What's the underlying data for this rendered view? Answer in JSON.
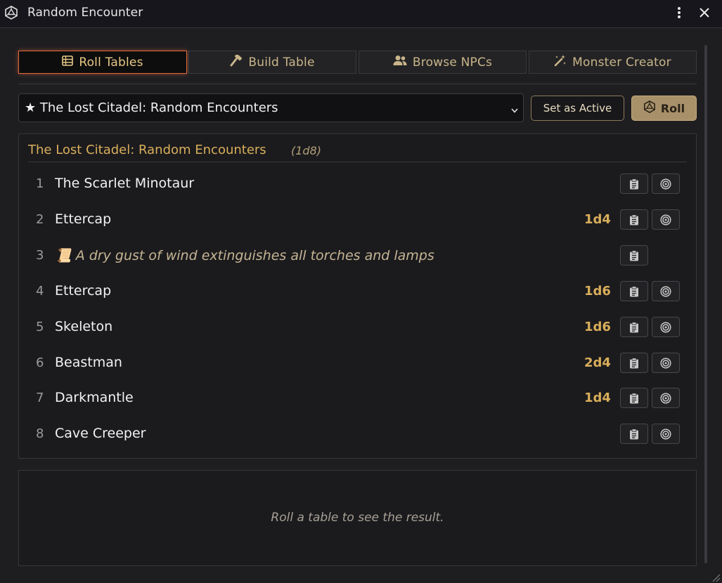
{
  "window": {
    "title": "Random Encounter",
    "icons": {
      "app": "d20-icon",
      "menu": "kebab-menu-icon",
      "close": "close-icon"
    }
  },
  "tabs": [
    {
      "label": "Roll Tables",
      "icon": "table-icon",
      "active": true
    },
    {
      "label": "Build Table",
      "icon": "hammer-icon",
      "active": false
    },
    {
      "label": "Browse NPCs",
      "icon": "users-icon",
      "active": false
    },
    {
      "label": "Monster Creator",
      "icon": "magic-wand-icon",
      "active": false
    }
  ],
  "table_select": {
    "selected": "★ The Lost Citadel: Random Encounters"
  },
  "buttons": {
    "set_active": "Set as Active",
    "roll": "Roll"
  },
  "table": {
    "title": "The Lost Citadel: Random Encounters",
    "dice": "(1d8)",
    "rows": [
      {
        "num": "1",
        "name": "The Scarlet Minotaur",
        "dice": "",
        "type": "monster"
      },
      {
        "num": "2",
        "name": "Ettercap",
        "dice": "1d4",
        "type": "monster"
      },
      {
        "num": "3",
        "name": "📜 A dry gust of wind extinguishes all torches and lamps",
        "dice": "",
        "type": "event"
      },
      {
        "num": "4",
        "name": "Ettercap",
        "dice": "1d6",
        "type": "monster"
      },
      {
        "num": "5",
        "name": "Skeleton",
        "dice": "1d6",
        "type": "monster"
      },
      {
        "num": "6",
        "name": "Beastman",
        "dice": "2d4",
        "type": "monster"
      },
      {
        "num": "7",
        "name": "Darkmantle",
        "dice": "1d4",
        "type": "monster"
      },
      {
        "num": "8",
        "name": "Cave Creeper",
        "dice": "",
        "type": "monster"
      }
    ]
  },
  "result": {
    "placeholder": "Roll a table to see the result."
  },
  "colors": {
    "accent_gold": "#d9ae5a",
    "active_tab_border": "#e06b3c",
    "roll_button": "#a8916a"
  }
}
